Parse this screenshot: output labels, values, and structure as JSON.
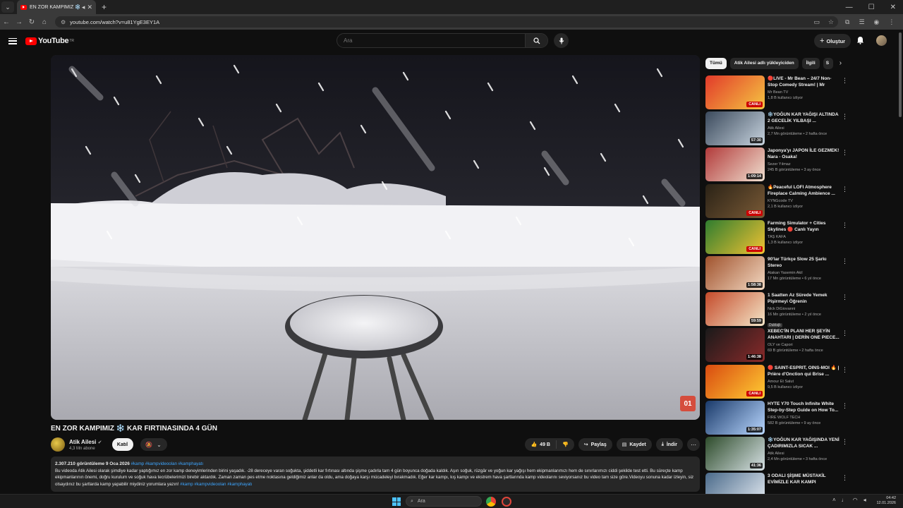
{
  "browser": {
    "tab_title": "EN ZOR KAMPIMIZ ❄️ KAR",
    "url": "youtube.com/watch?v=u81YgE3EY1A"
  },
  "masthead": {
    "logo_text": "YouTube",
    "logo_region": "TR",
    "search_placeholder": "Ara",
    "create_label": "Oluştur"
  },
  "video": {
    "watermark": "01",
    "title": "EN ZOR KAMPIMIZ ❄️ KAR FIRTINASINDA 4 GÜN",
    "channel": "Atik Ailesi",
    "subscribers": "4,3 Mn abone",
    "join_label": "Katıl",
    "likes": "49 B",
    "share_label": "Paylaş",
    "save_label": "Kaydet",
    "download_label": "İndir",
    "views_date": "2.307.210 görüntüleme  9 Oca 2026",
    "header_tags": "#kamp #kampvideoolan #kamphayatı",
    "description": "Bu videoda Atik Ailesi olarak şimdiye kadar yaptığımız en zor kamp deneyimlerinden birini yaşadık. -28 dereceye varan soğukta, şiddetli kar fırtınası altında şişme çadırla tam 4 gün boyunca doğada kaldık. Aşırı soğuk, rüzgâr ve yoğun kar yağışı hem ekipmanlarımızı hem de sınırlarımızı ciddi şekilde test etti. Bu süreçte kamp ekipmanlarının önemi, doğru kurulum ve soğuk hava tecrübelerimizi birebir aktardık. Zaman zaman pes etme noktasına geldiğimiz anlar da oldu, ama doğaya karşı mücadeleyi bırakmadık. Eğer kar kampı, kış kampı ve ekstrem hava şartlarında kamp videolarını seviyorsanız bu video tam size göre.Videoyu sonuna kadar izleyin, siz olsaydınız bu şartlarda kamp yapabilir miydiniz yorumlara yazın!",
    "footer_tags": "#kamp #kampvideoolan #kamphayatı"
  },
  "sidebar": {
    "chips": [
      "Tümü",
      "Atik Ailesi adlı yükleyiciden",
      "İlgili",
      "S"
    ],
    "items": [
      {
        "title": "🔴LIVE - Mr Bean – 24/7 Non-Stop Comedy Stream! | Mr Bean...",
        "channel": "Mr Bean TV",
        "meta": "1,8 B kullanıcı izliyor",
        "badge": "CANLI",
        "thumb_a": "#e23a2a",
        "thumb_b": "#f5c542"
      },
      {
        "title": "❄️YOĞUN KAR YAĞIŞI ALTINDA 2 GECELİK YILBAŞI ...",
        "channel": "Atik Ailesi",
        "meta": "2,7 Mn görüntüleme • 2 hafta önce",
        "badge": "57:30",
        "thumb_a": "#3b4a5c",
        "thumb_b": "#c7d3de"
      },
      {
        "title": "Japonya'yı JAPON İLE GEZMEK! Nara - Osaka!",
        "channel": "Sezer Yılmaz",
        "meta": "245 B görüntüleme • 3 ay önce",
        "badge": "1:09:14",
        "thumb_a": "#b23a3a",
        "thumb_b": "#f0e0d0"
      },
      {
        "title": "🔥Peaceful LOFI Atmosphere Fireplace Calming Ambience ...",
        "channel": "KYNGcode TV",
        "meta": "2,1 B kullanıcı izliyor",
        "badge": "CANLI",
        "thumb_a": "#2a2216",
        "thumb_b": "#7a5a36"
      },
      {
        "title": "Farming Simulator + Cities Skylines 🔴 Canlı Yayın",
        "channel": "TAŞ KAFA",
        "meta": "1,3 B kullanıcı izliyor",
        "badge": "CANLI",
        "thumb_a": "#2f7d2f",
        "thumb_b": "#f1c232"
      },
      {
        "title": "90'lar Türkçe Slow 25 Şarkı Stereo",
        "channel": "Atakan Yasemin Akil",
        "meta": "17 Mn görüntüleme • 6 yıl önce",
        "badge": "1:58:38",
        "thumb_a": "#a0522d",
        "thumb_b": "#f3d9c2"
      },
      {
        "title": "1 Saatten Az Sürede Yemek Pişirmeyi Öğrenin",
        "channel": "Nick DiGiovanni",
        "meta": "16 Mn görüntüleme • 2 yıl önce",
        "extra": "Dublajlı",
        "badge": "59:59",
        "thumb_a": "#c44a2a",
        "thumb_b": "#f4e6c8"
      },
      {
        "title": "XEBEC'İN PLANI HER ŞEYİN ANAHTARI | DERİN ONE PIECE...",
        "channel": "OLY ve Capori",
        "meta": "69 B görüntüleme • 2 hafta önce",
        "badge": "1:46:38",
        "thumb_a": "#1a1a1a",
        "thumb_b": "#8a2a2a"
      },
      {
        "title": "🔴 SAINT-ESPRIT, OINS-MOI 🔥 | Prière d'Onction qui Brise ...",
        "channel": "Amour Et Salut",
        "meta": "9,5 B kullanıcı izliyor",
        "badge": "CANLI",
        "thumb_a": "#d94a10",
        "thumb_b": "#ffcc33"
      },
      {
        "title": "HYTE Y70 Touch Infinite White Step-by-Step Guide on How To...",
        "channel": "FIRE WOLF TECH",
        "meta": "582 B görüntüleme • 9 ay önce",
        "badge": "1:35:07",
        "thumb_a": "#1a3a6a",
        "thumb_b": "#b9d7ff"
      },
      {
        "title": "❄️YOĞUN KAR YAĞIŞINDA YENİ ÇADIRIMIZLA SICAK ...",
        "channel": "Atik Ailesi",
        "meta": "2,4 Mn görüntüleme • 3 hafta önce",
        "badge": "41:36",
        "thumb_a": "#2d4b2a",
        "thumb_b": "#d8e2e6"
      },
      {
        "title": "3 ODALI ŞİŞME MÜSTAKİL EVİMİZLE KAR KAMPI",
        "channel": "",
        "meta": "",
        "badge": "",
        "thumb_a": "#4a6a8a",
        "thumb_b": "#e8eef4"
      }
    ]
  },
  "taskbar": {
    "search_placeholder": "Ara",
    "time": "04:42",
    "date": "12.01.2026"
  },
  "colors": {
    "accent": "#ff0000",
    "link": "#3ea6ff",
    "bg": "#0f0f0f"
  }
}
